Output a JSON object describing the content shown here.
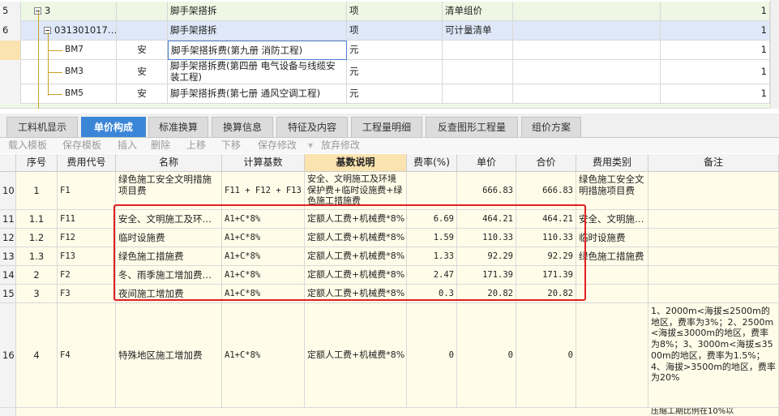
{
  "tree": {
    "rows": [
      {
        "num": "5",
        "code": "3",
        "name": "脚手架搭拆",
        "unit": "项",
        "type": "清单组价",
        "qty": "1"
      },
      {
        "num": "6",
        "code": "031301017…",
        "name": "脚手架搭拆",
        "unit": "项",
        "type": "可计量清单",
        "qty": "1"
      },
      {
        "num": "",
        "code": "BM7",
        "cat": "安",
        "name": "脚手架搭拆费(第九册 消防工程)",
        "unit": "元",
        "qty": "1"
      },
      {
        "num": "",
        "code": "BM3",
        "cat": "安",
        "name": "脚手架搭拆费(第四册 电气设备与线缆安装工程)",
        "unit": "元",
        "qty": "1"
      },
      {
        "num": "",
        "code": "BM5",
        "cat": "安",
        "name": "脚手架搭拆费(第七册 通风空调工程)",
        "unit": "元",
        "qty": "1"
      }
    ]
  },
  "tabs": [
    "工料机显示",
    "单价构成",
    "标准换算",
    "换算信息",
    "特征及内容",
    "工程量明细",
    "反查图形工程量",
    "组价方案"
  ],
  "toolbar": [
    "载入模板",
    "保存模板",
    "插入",
    "删除",
    "上移",
    "下移",
    "保存修改",
    "放弃修改"
  ],
  "fee_table": {
    "headers": [
      "序号",
      "费用代号",
      "名称",
      "计算基数",
      "基数说明",
      "费率(%)",
      "单价",
      "合价",
      "费用类别",
      "备注"
    ],
    "rows": [
      {
        "row": "10",
        "seq": "1",
        "code": "F1",
        "name": "绿色施工安全文明措施项目费",
        "base": "F11 + F12 + F13",
        "desc": "安全、文明施工及环境保护费+临时设施费+绿色施工措施费",
        "rate": "",
        "price": "666.83",
        "total": "666.83",
        "category": "绿色施工安全文明措施项目费",
        "note": ""
      },
      {
        "row": "11",
        "seq": "1.1",
        "code": "F11",
        "name": "安全、文明施工及环…",
        "base": "A1+C*8%",
        "desc": "定额人工费+机械费*8%",
        "rate": "6.69",
        "price": "464.21",
        "total": "464.21",
        "category": "安全、文明施…",
        "note": ""
      },
      {
        "row": "12",
        "seq": "1.2",
        "code": "F12",
        "name": "临时设施费",
        "base": "A1+C*8%",
        "desc": "定额人工费+机械费*8%",
        "rate": "1.59",
        "price": "110.33",
        "total": "110.33",
        "category": "临时设施费",
        "note": ""
      },
      {
        "row": "13",
        "seq": "1.3",
        "code": "F13",
        "name": "绿色施工措施费",
        "base": "A1+C*8%",
        "desc": "定额人工费+机械费*8%",
        "rate": "1.33",
        "price": "92.29",
        "total": "92.29",
        "category": "绿色施工措施费",
        "note": ""
      },
      {
        "row": "14",
        "seq": "2",
        "code": "F2",
        "name": "冬、雨季施工增加费…",
        "base": "A1+C*8%",
        "desc": "定额人工费+机械费*8%",
        "rate": "2.47",
        "price": "171.39",
        "total": "171.39",
        "category": "",
        "note": ""
      },
      {
        "row": "15",
        "seq": "3",
        "code": "F3",
        "name": "夜间施工增加费",
        "base": "A1+C*8%",
        "desc": "定额人工费+机械费*8%",
        "rate": "0.3",
        "price": "20.82",
        "total": "20.82",
        "category": "",
        "note": ""
      },
      {
        "row": "16",
        "seq": "4",
        "code": "F4",
        "name": "特殊地区施工增加费",
        "base": "A1+C*8%",
        "desc": "定额人工费+机械费*8%",
        "rate": "0",
        "price": "0",
        "total": "0",
        "category": "",
        "note": "1、2000m<海拔≤2500m的地区，费率为3%；2、2500m<海拔≤3000m的地区，费率为8%；3、3000m<海拔≤3500m的地区，费率为1.5%；4、海拔>3500m的地区，费率为20%"
      }
    ],
    "next_note": "压缩工期比例在10%以"
  }
}
